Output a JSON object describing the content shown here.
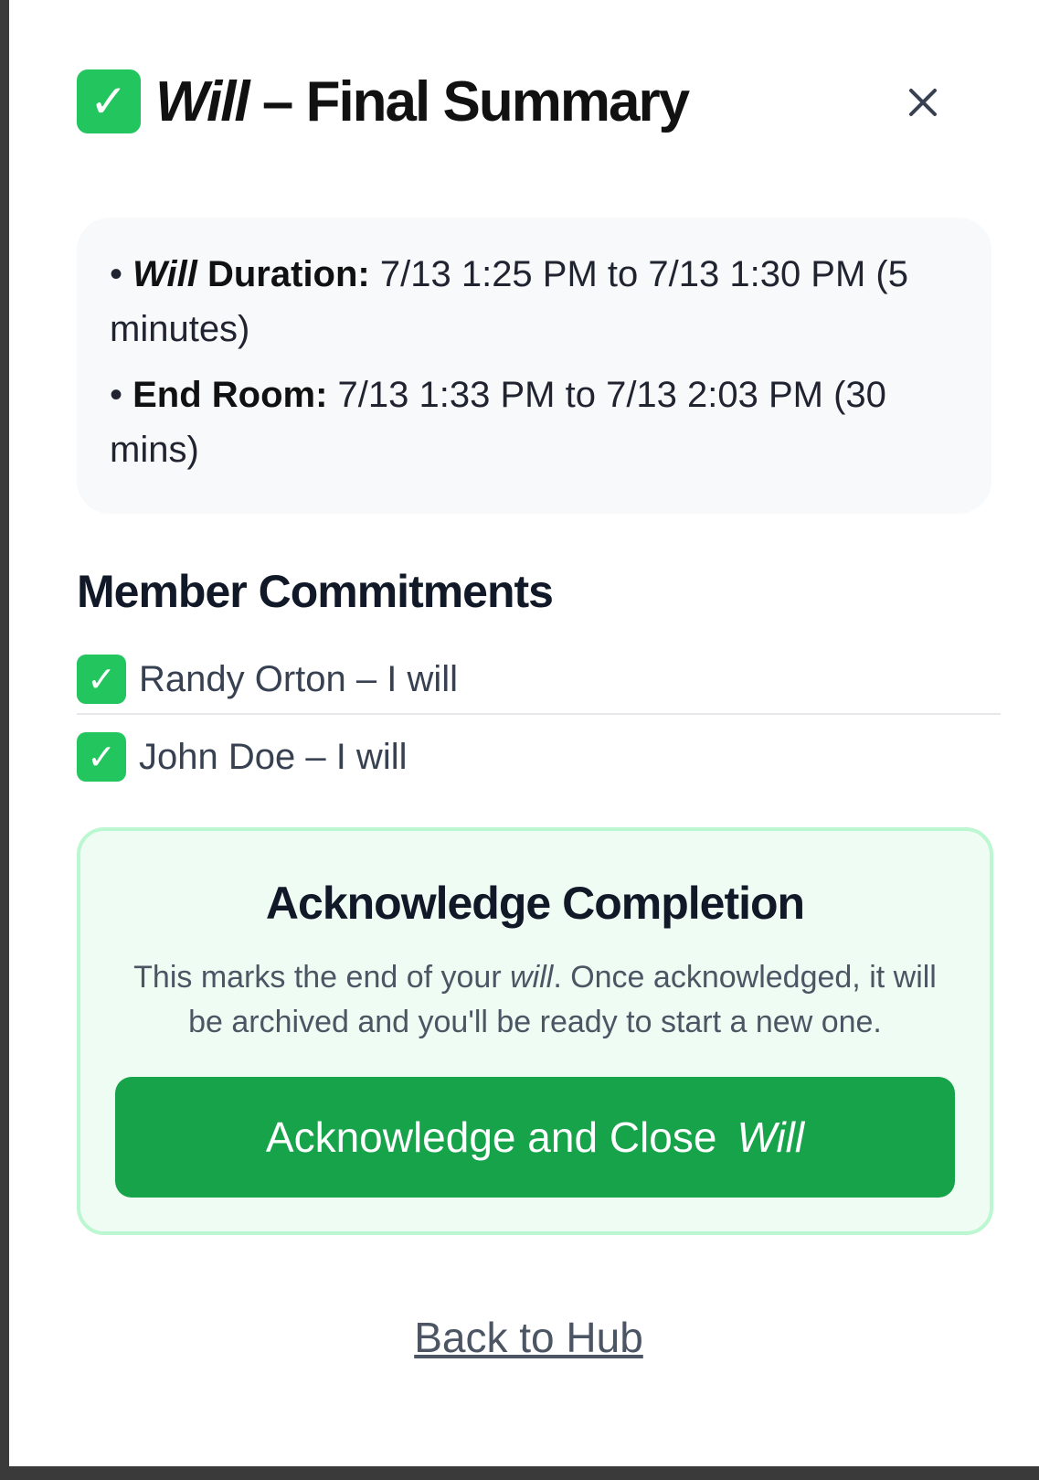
{
  "header": {
    "check_glyph": "✓",
    "title_italic": "Will",
    "title_rest": " – Final Summary",
    "close_glyph": "×"
  },
  "details": {
    "duration": {
      "bullet": "• ",
      "label_italic": "Will",
      "label": " Duration:",
      "value": " 7/13 1:25 PM to 7/13 1:30 PM (5 minutes)"
    },
    "end_room": {
      "bullet": "• ",
      "label": "End Room:",
      "value": " 7/13 1:33 PM to 7/13 2:03 PM (30 mins)"
    }
  },
  "commitments": {
    "title": "Member Commitments",
    "members": [
      {
        "check_glyph": "✓",
        "text": "Randy Orton – I will"
      },
      {
        "check_glyph": "✓",
        "text": "John Doe – I will"
      }
    ]
  },
  "acknowledge": {
    "title": "Acknowledge Completion",
    "text_before": "This marks the end of your ",
    "text_italic": "will",
    "text_after": ". Once acknowledged, it will be archived and you'll be ready to start a new one.",
    "button_label": "Acknowledge and Close",
    "button_italic": "Will"
  },
  "footer": {
    "back_link": "Back to Hub"
  },
  "colors": {
    "accent_green": "#16a34a",
    "check_green": "#22c55e",
    "panel_green_bg": "#effcf3",
    "panel_green_border": "#bbf7d0"
  },
  "icons": {
    "title_icon": "check-mark-button-icon",
    "close_icon": "close-icon",
    "member_icon": "check-mark-button-icon"
  }
}
